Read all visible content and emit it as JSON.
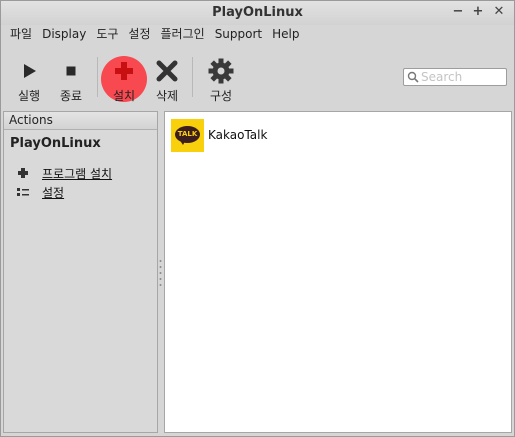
{
  "window": {
    "title": "PlayOnLinux",
    "controls": [
      "−",
      "+",
      "✕"
    ]
  },
  "menu": [
    "파일",
    "Display",
    "도구",
    "설정",
    "플러그인",
    "Support",
    "Help"
  ],
  "toolbar": {
    "run_label": "실행",
    "stop_label": "종료",
    "install_label": "설치",
    "remove_label": "삭제",
    "configure_label": "구성",
    "search_placeholder": "Search",
    "highlight_color": "#ff2832"
  },
  "sidebar": {
    "header": "Actions",
    "app_name": "PlayOnLinux",
    "actions": [
      {
        "label": "프로그램 설치",
        "icon": "plus-icon"
      },
      {
        "label": "설정",
        "icon": "settings-list-icon"
      }
    ]
  },
  "apps": [
    {
      "name": "KakaoTalk",
      "icon": "kakaotalk-icon",
      "icon_text": "TALK",
      "icon_color": "#f8d10c"
    }
  ]
}
